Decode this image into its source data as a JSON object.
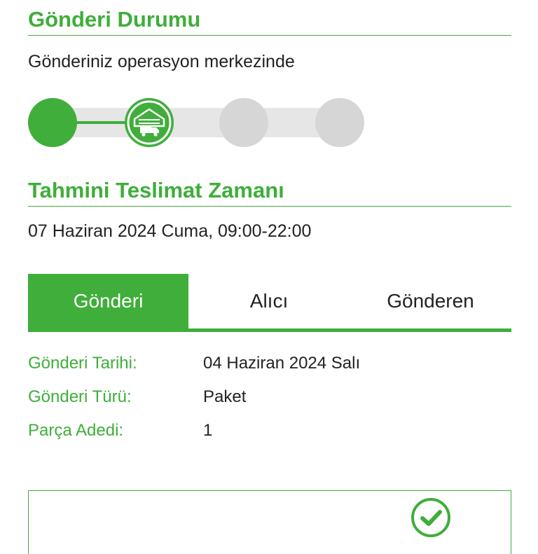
{
  "shipment_status": {
    "title": "Gönderi Durumu",
    "status_text": "Gönderiniz operasyon merkezinde",
    "steps_completed": 2,
    "steps_total": 4
  },
  "delivery_estimate": {
    "title": "Tahmini Teslimat Zamanı",
    "time_text": "07 Haziran 2024 Cuma, 09:00-22:00"
  },
  "tabs": [
    {
      "label": "Gönderi",
      "active": true
    },
    {
      "label": "Alıcı",
      "active": false
    },
    {
      "label": "Gönderen",
      "active": false
    }
  ],
  "details": [
    {
      "label": "Gönderi Tarihi:",
      "value": "04 Haziran 2024 Salı"
    },
    {
      "label": "Gönderi Türü:",
      "value": "Paket"
    },
    {
      "label": "Parça Adedi:",
      "value": "1"
    }
  ],
  "colors": {
    "accent": "#3fae3a",
    "inactive": "#d6d6d6",
    "track": "#e6e6e6"
  },
  "icons": {
    "step2": "warehouse-truck-icon",
    "card": "check-circle-icon"
  }
}
